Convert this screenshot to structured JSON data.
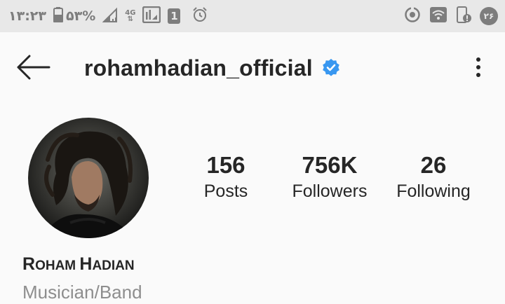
{
  "status_bar": {
    "time": "۱۳:۲۳",
    "battery": "۵۳%",
    "network_type": "4G",
    "sim_slot": "1",
    "notification_count": "۲۶",
    "icons": [
      "battery-icon",
      "signal-icon",
      "network-4g-icon",
      "data-usage-icon",
      "sim-icon",
      "alarm-icon",
      "data-saver-icon",
      "wifi-icon",
      "phone-alert-icon"
    ]
  },
  "header": {
    "username": "rohamhadian_official",
    "verified": true,
    "back_icon": "back-arrow-icon",
    "more_icon": "more-options-icon",
    "accent_color": "#3897f0"
  },
  "profile": {
    "avatar_icon": "profile-avatar",
    "stats": [
      {
        "value": "156",
        "label": "Posts"
      },
      {
        "value": "756K",
        "label": "Followers"
      },
      {
        "value": "26",
        "label": "Following"
      }
    ],
    "name_parts": [
      "R",
      "OHAM ",
      "H",
      "ADIAN"
    ],
    "category": "Musician/Band"
  }
}
